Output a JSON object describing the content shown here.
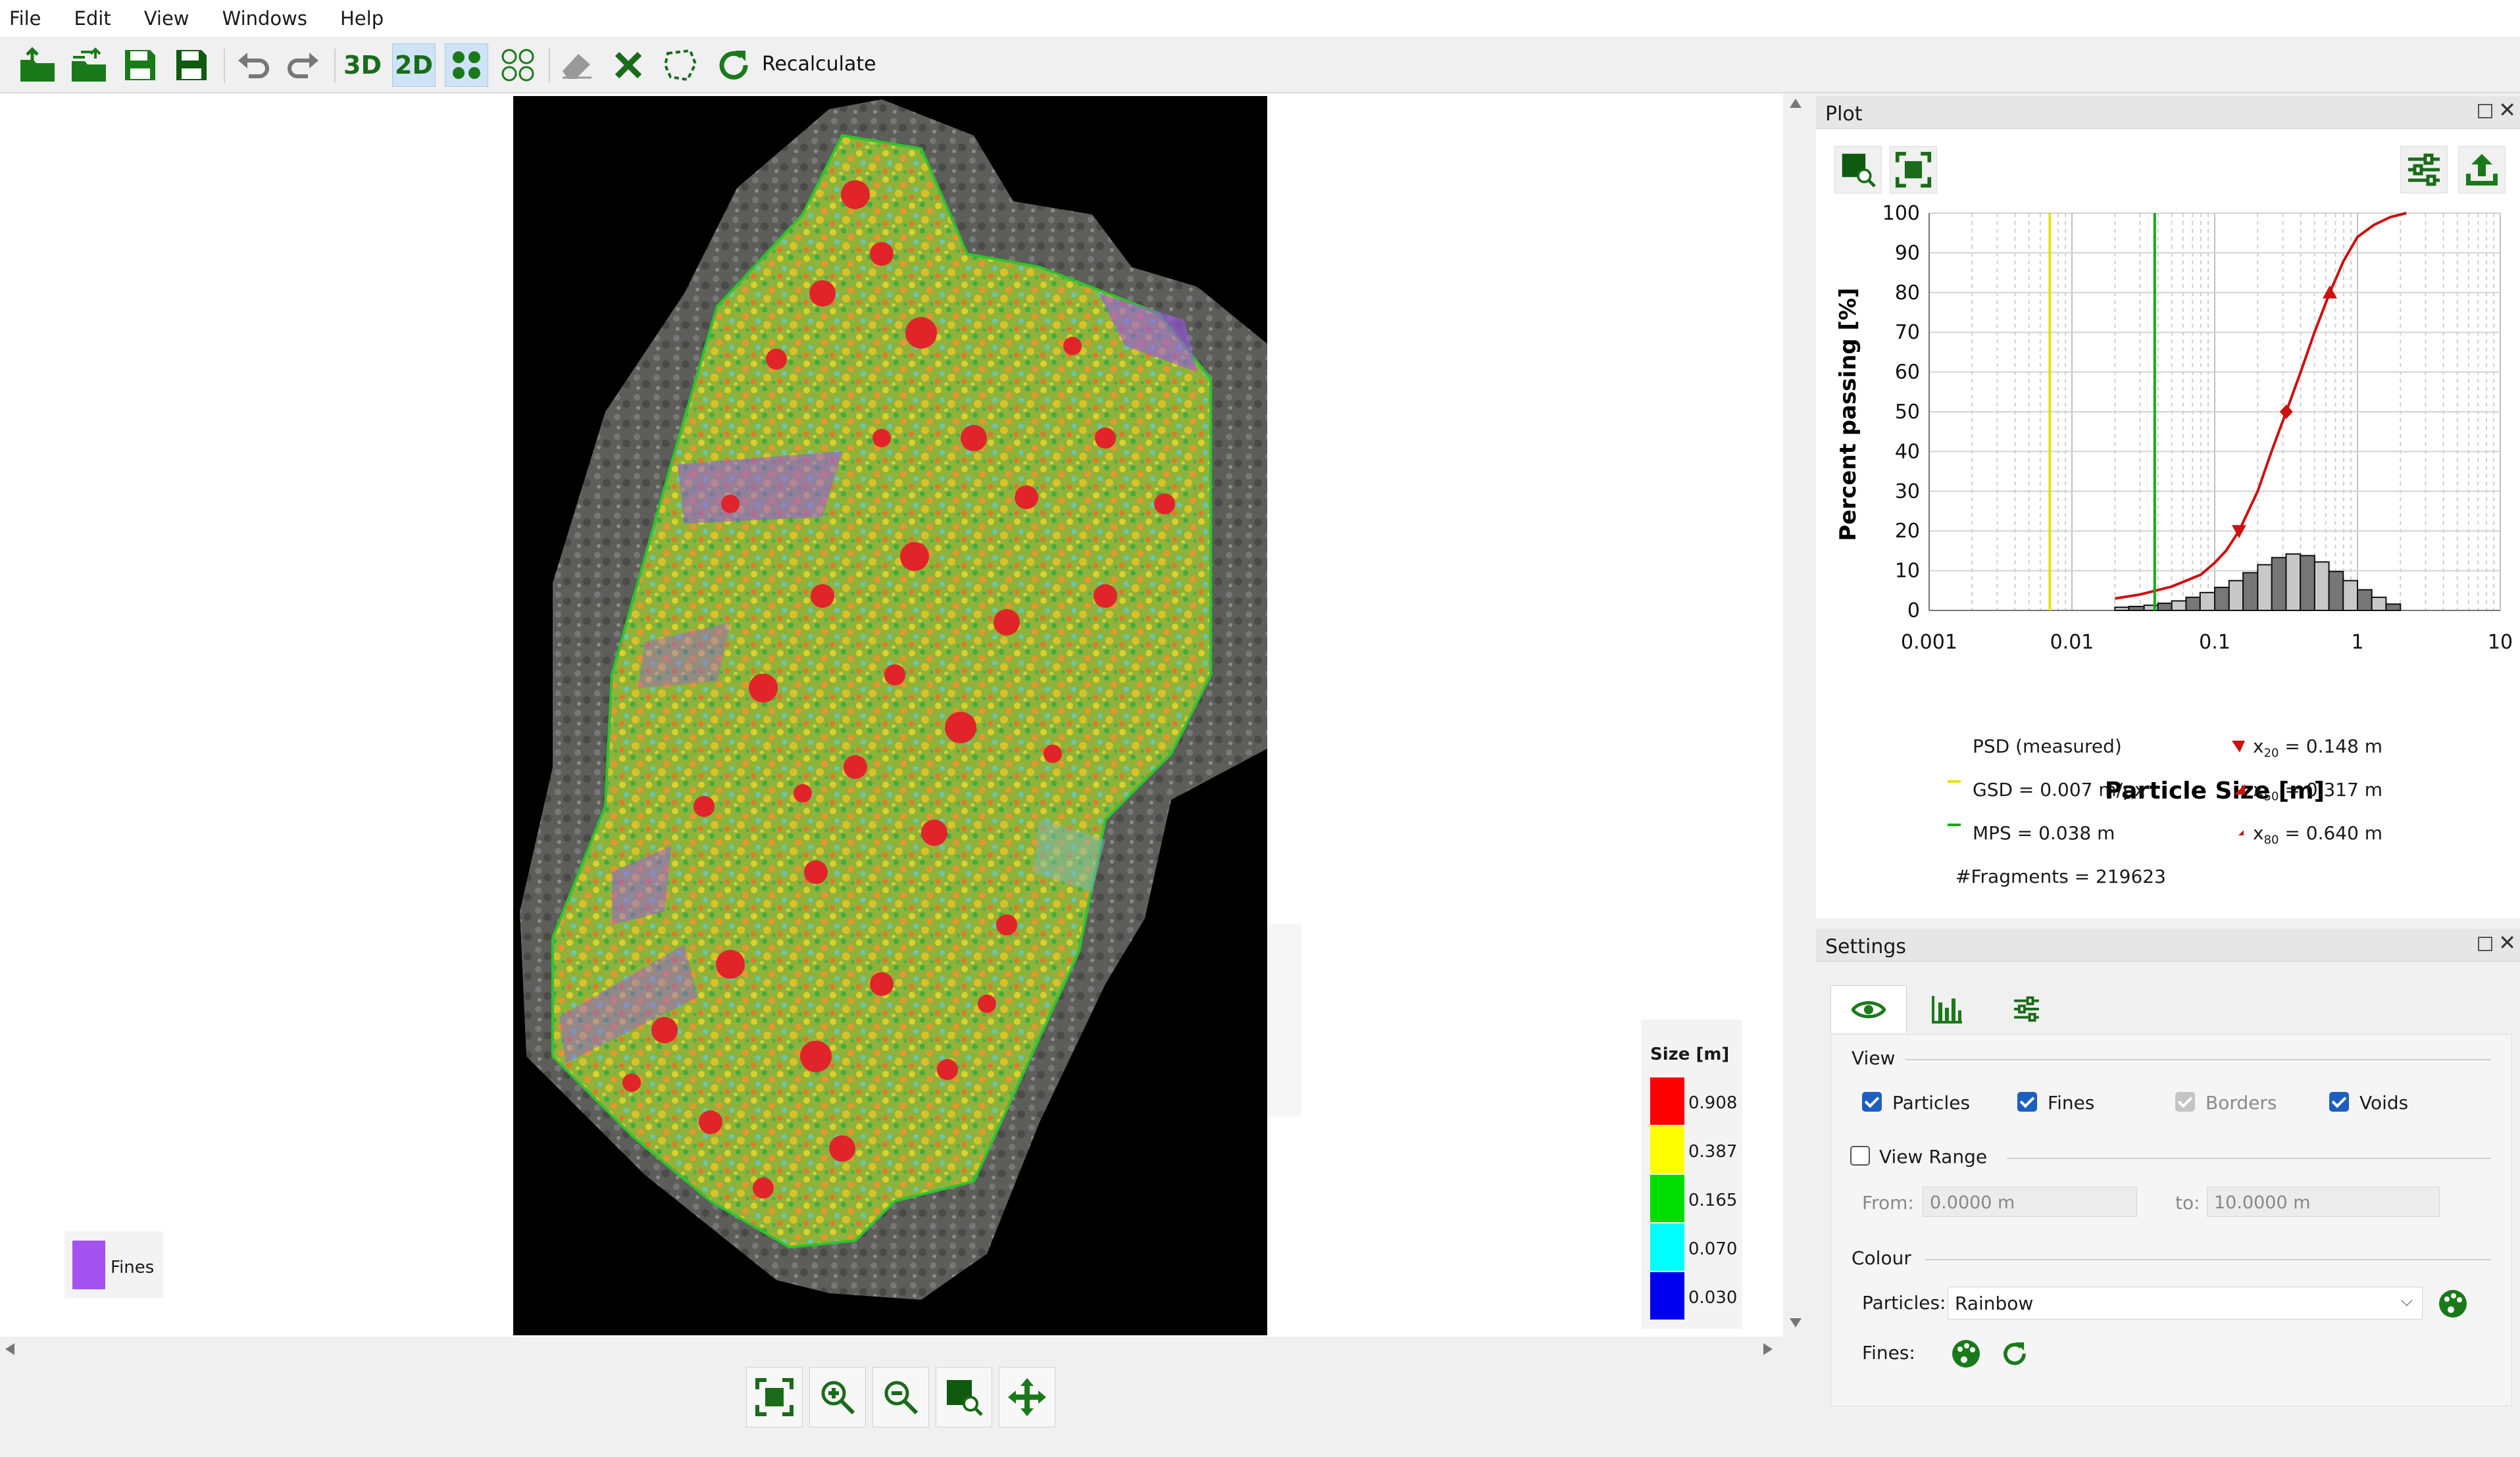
{
  "menu": [
    "File",
    "Edit",
    "View",
    "Windows",
    "Help"
  ],
  "toolbar": {
    "icons": [
      "open-folder-icon",
      "import-folder-icon",
      "save-icon",
      "save-as-icon",
      "undo-icon",
      "redo-icon",
      "3d-view",
      "2d-view",
      "particles-view-icon",
      "outline-view-icon",
      "eraser-icon",
      "delete-icon",
      "lasso-icon",
      "recalculate-icon"
    ],
    "label_3d": "3D",
    "label_2d": "2D",
    "recalculate_label": "Recalculate",
    "active_view": "2D"
  },
  "legend": {
    "title": "Size [m]",
    "entries": [
      {
        "color": "#ff0000",
        "value": "0.908"
      },
      {
        "color": "#ffff00",
        "value": "0.387"
      },
      {
        "color": "#00dd00",
        "value": "0.165"
      },
      {
        "color": "#00ffff",
        "value": "0.070"
      },
      {
        "color": "#0000ee",
        "value": "0.030"
      }
    ]
  },
  "fines_legend": {
    "label": "Fines",
    "color": "#a353f0"
  },
  "nav_icons": [
    "fit-view-icon",
    "zoom-in-icon",
    "zoom-out-icon",
    "zoom-region-icon",
    "pan-icon"
  ],
  "plot_panel": {
    "title": "Plot",
    "info": {
      "psd_label": "PSD (measured)",
      "gsd": "GSD = 0.007 m/px",
      "mps": "MPS = 0.038 m",
      "fragments": "#Fragments = 219623",
      "x20_sub": "20",
      "x20_val": "= 0.148 m",
      "x50_sub": "50",
      "x50_val": "= 0.317 m",
      "x80_sub": "80",
      "x80_val": "= 0.640 m",
      "x_letter": "x"
    }
  },
  "chart_data": {
    "type": "line",
    "xlabel": "Particle Size [m]",
    "ylabel": "Percent passing [%]",
    "xscale": "log",
    "xlim": [
      0.001,
      10
    ],
    "ylim": [
      0,
      100
    ],
    "xticks": [
      "0.001",
      "0.01",
      "0.1",
      "1",
      "10"
    ],
    "yticks": [
      "0",
      "10",
      "20",
      "30",
      "40",
      "50",
      "60",
      "70",
      "80",
      "90",
      "100"
    ],
    "grid": true,
    "series": [
      {
        "kind": "line",
        "color": "#cc1111",
        "x": [
          0.02,
          0.03,
          0.05,
          0.08,
          0.1,
          0.12,
          0.148,
          0.2,
          0.25,
          0.317,
          0.4,
          0.5,
          0.64,
          0.8,
          1,
          1.3,
          1.7,
          2.2
        ],
        "y": [
          3,
          4,
          6,
          9,
          12,
          15,
          20,
          30,
          40,
          50,
          60,
          70,
          80,
          88,
          94,
          97,
          99,
          100
        ]
      },
      {
        "kind": "vline",
        "name": "GSD",
        "x": 0.007,
        "color": "#e3e300"
      },
      {
        "kind": "vline",
        "name": "MPS",
        "x": 0.038,
        "color": "#1aa81a"
      },
      {
        "kind": "bar",
        "edges": [
          0.02,
          0.025,
          0.032,
          0.04,
          0.05,
          0.063,
          0.079,
          0.1,
          0.126,
          0.158,
          0.2,
          0.251,
          0.316,
          0.398,
          0.501,
          0.631,
          0.794,
          1.0,
          1.259,
          1.585,
          2.0
        ],
        "values": [
          0.8,
          1.0,
          1.3,
          1.8,
          2.4,
          3.3,
          4.5,
          5.8,
          7.5,
          9.5,
          11.5,
          13.3,
          14.2,
          13.8,
          12.2,
          9.8,
          7.5,
          5.2,
          3.3,
          1.6
        ]
      }
    ],
    "markers": [
      {
        "label": "x20",
        "x": 0.148,
        "y": 20,
        "shape": "triangle-down"
      },
      {
        "label": "x50",
        "x": 0.317,
        "y": 50,
        "shape": "diamond"
      },
      {
        "label": "x80",
        "x": 0.64,
        "y": 80,
        "shape": "triangle-up"
      }
    ]
  },
  "settings_panel": {
    "title": "Settings",
    "tabs": [
      "eye-icon",
      "histogram-icon",
      "sliders-icon"
    ],
    "view_section": "View",
    "particles": "Particles",
    "fines": "Fines",
    "borders": "Borders",
    "voids": "Voids",
    "view_range": "View Range",
    "from_label": "From:",
    "from_value": "0.0000 m",
    "to_label": "to:",
    "to_value": "10.0000 m",
    "colour_section": "Colour",
    "particles_colour_label": "Particles:",
    "particles_colour_value": "Rainbow",
    "fines_colour_label": "Fines:"
  }
}
